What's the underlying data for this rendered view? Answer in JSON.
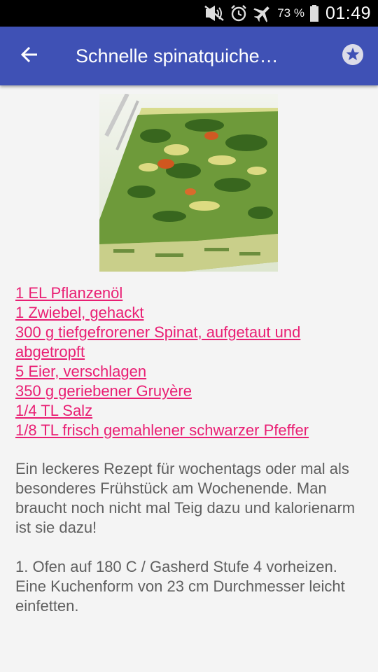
{
  "status_bar": {
    "battery_percent": "73 %",
    "time": "01:49",
    "icons": [
      "mute-icon",
      "alarm-icon",
      "airplane-mode-icon",
      "battery-icon"
    ]
  },
  "app_bar": {
    "title": "Schnelle spinatquiche…",
    "back_icon": "arrow-back-icon",
    "favorite_icon": "star-icon"
  },
  "recipe": {
    "image_alt": "spinach quiche",
    "ingredients": [
      "1 EL Pflanzenöl",
      "1 Zwiebel, gehackt",
      "300 g tiefgefrorener Spinat, aufgetaut und abgetropft",
      "5 Eier, verschlagen",
      "350 g geriebener Gruyère",
      "1/4 TL Salz",
      "1/8 TL frisch gemahlener schwarzer Pfeffer"
    ],
    "description": "Ein leckeres Rezept für wochentags oder mal als besonderes Frühstück am Wochenende. Man braucht noch nicht mal Teig dazu und kalorienarm ist sie dazu!",
    "steps": [
      "1. Ofen auf 180 C / Gasherd Stufe 4 vorheizen. Eine Kuchenform von 23 cm Durchmesser leicht einfetten."
    ]
  },
  "colors": {
    "app_bar": "#3f51b5",
    "ingredient_link": "#e91e73",
    "body_text": "#5f5f5f",
    "background": "#f4f4f4"
  }
}
